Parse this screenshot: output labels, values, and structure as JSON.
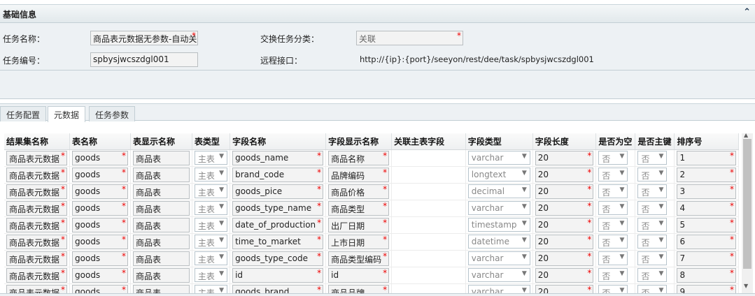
{
  "section": {
    "title": "基础信息",
    "collapse_icon": "double-chevron-up-icon"
  },
  "form": {
    "task_name_label": "任务名称：",
    "task_name_value": "商品表元数据无参数-自动关",
    "task_category_label": "交换任务分类：",
    "task_category_value": "关联",
    "task_code_label": "任务编号：",
    "task_code_value": "spbysjwcszdgl001",
    "remote_api_label": "远程接口：",
    "remote_api_value": "http://{ip}:{port}/seeyon/rest/dee/task/spbysjwcszdgl001"
  },
  "tabs": [
    {
      "label": "任务配置"
    },
    {
      "label": "元数据",
      "active": true
    },
    {
      "label": "任务参数"
    }
  ],
  "table": {
    "columns": [
      "结果集名称",
      "表名称",
      "表显示名称",
      "表类型",
      "字段名称",
      "字段显示名称",
      "关联主表字段",
      "字段类型",
      "字段长度",
      "是否为空",
      "是否主键",
      "排序号"
    ],
    "rows": [
      [
        "商品表元数据",
        "goods",
        "商品表",
        "主表",
        "goods_name",
        "商品名称",
        "",
        "varchar",
        "20",
        "否",
        "否",
        "1"
      ],
      [
        "商品表元数据",
        "goods",
        "商品表",
        "主表",
        "brand_code",
        "品牌编码",
        "",
        "longtext",
        "20",
        "否",
        "否",
        "2"
      ],
      [
        "商品表元数据",
        "goods",
        "商品表",
        "主表",
        "goods_pice",
        "商品价格",
        "",
        "decimal",
        "20",
        "否",
        "否",
        "3"
      ],
      [
        "商品表元数据",
        "goods",
        "商品表",
        "主表",
        "goods_type_name",
        "商品类型",
        "",
        "varchar",
        "20",
        "否",
        "否",
        "4"
      ],
      [
        "商品表元数据",
        "goods",
        "商品表",
        "主表",
        "date_of_production",
        "出厂日期",
        "",
        "timestamp",
        "20",
        "否",
        "否",
        "5"
      ],
      [
        "商品表元数据",
        "goods",
        "商品表",
        "主表",
        "time_to_market",
        "上市日期",
        "",
        "datetime",
        "20",
        "否",
        "否",
        "6"
      ],
      [
        "商品表元数据",
        "goods",
        "商品表",
        "主表",
        "goods_type_code",
        "商品类型编码",
        "",
        "varchar",
        "20",
        "否",
        "否",
        "7"
      ],
      [
        "商品表元数据",
        "goods",
        "商品表",
        "主表",
        "id",
        "id",
        "",
        "varchar",
        "20",
        "否",
        "否",
        "8"
      ],
      [
        "商品表元数据",
        "goods",
        "商品表",
        "主表",
        "goods_brand",
        "商品品牌",
        "",
        "varchar",
        "20",
        "否",
        "否",
        "9"
      ]
    ]
  },
  "required_mark": "*"
}
